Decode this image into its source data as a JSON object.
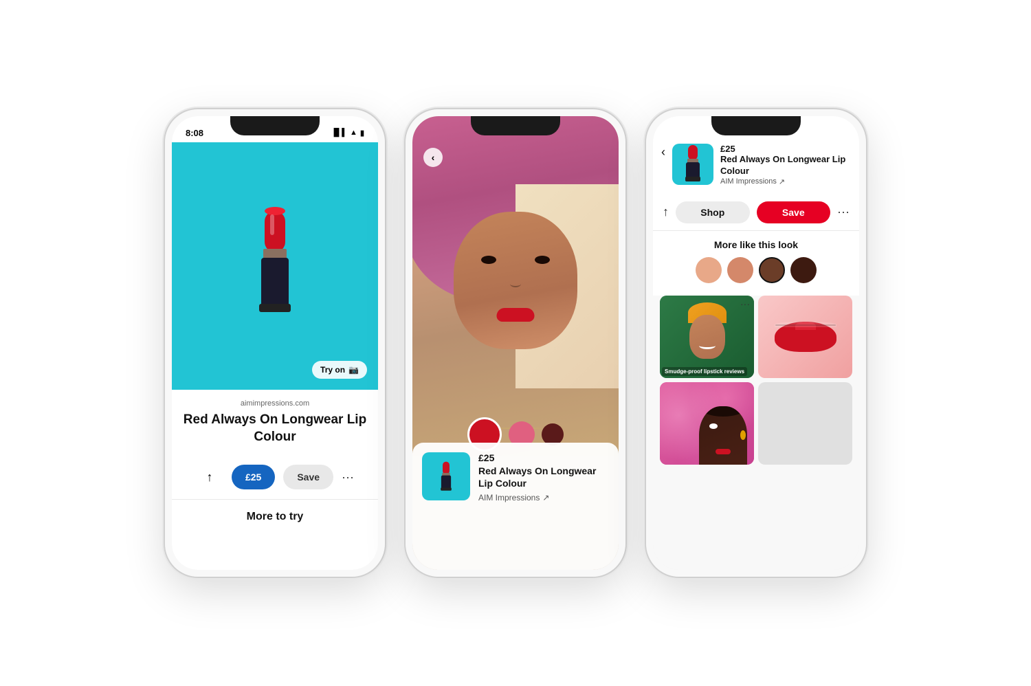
{
  "page": {
    "bg_color": "#ffffff"
  },
  "phone1": {
    "status_time": "8:08",
    "site_url": "aimimpressions.com",
    "product_title": "Red Always On Longwear Lip Colour",
    "price": "£25",
    "save_label": "Save",
    "more_to_try": "More to try",
    "try_on_label": "Try on",
    "share_icon": "↑",
    "dots_icon": "···"
  },
  "phone2": {
    "back_icon": "‹",
    "product_price": "£25",
    "product_name": "Red Always On Longwear Lip Colour",
    "brand": "AIM Impressions",
    "arrow_icon": "↗"
  },
  "phone3": {
    "back_icon": "‹",
    "product_price": "£25",
    "product_title": "Red Always On Longwear Lip Colour",
    "brand": "AIM Impressions",
    "arrow_icon": "↗",
    "share_icon": "↑",
    "shop_label": "Shop",
    "save_label": "Save",
    "dots_icon": "···",
    "more_like_title": "More like this look",
    "grid_label": "Smudge-proof lipstick reviews",
    "grid_dots": "···",
    "save_color": "#e60023",
    "colors": [
      {
        "name": "peach",
        "hex": "#e8a888"
      },
      {
        "name": "nude-pink",
        "hex": "#d4886a"
      },
      {
        "name": "brown-selected",
        "hex": "#6b3d28"
      },
      {
        "name": "dark-brown",
        "hex": "#3d1a10"
      }
    ]
  }
}
